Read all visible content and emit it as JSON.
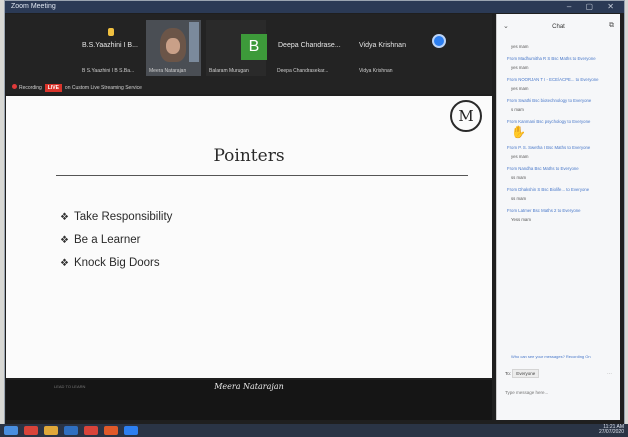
{
  "window": {
    "title": "Zoom Meeting"
  },
  "participants": [
    {
      "name": "B.S.Yaazhini I B...",
      "sub": "B S.Yaazhini I B S.Ba..."
    },
    {
      "name": "",
      "sub": "Meera Natarajan"
    },
    {
      "name": "",
      "avatar": "B",
      "sub": "Balaram Murugan"
    },
    {
      "name": "Deepa Chandrase...",
      "sub": "Deepa Chandrasekar..."
    },
    {
      "name": "Vidya Krishnan",
      "sub": "Vidya Krishnan"
    }
  ],
  "recording": {
    "label": "Recording",
    "live": "LIVE",
    "text": "on Custom Live Streaming Service"
  },
  "slide": {
    "logo": "M",
    "title": "Pointers",
    "bullets": [
      "Take Responsibility",
      "Be a Learner",
      "Knock Big Doors"
    ],
    "bullet_glyph": "❖",
    "footer_small": "LEAD TO LEARN",
    "footer_signature": "Meera Natarajan"
  },
  "chat": {
    "title": "Chat",
    "messages": [
      {
        "from": "",
        "text": "yes mam"
      },
      {
        "from": "From Madhumitha R S Bsc Maths to Everyone",
        "text": "yes mam"
      },
      {
        "from": "From NOORJAN T I - ECE/ACPE... to Everyone",
        "text": "yes mam"
      },
      {
        "from": "From Swathi Bsc biotechnology to Everyone",
        "text": "s mam"
      },
      {
        "from": "From Kanmani Bsc psychology to Everyone",
        "text": "",
        "thumb": true
      },
      {
        "from": "From P. S. Swetha I Bsc Maths to Everyone",
        "text": "yes mam"
      },
      {
        "from": "From Nandha Bsc Maths to Everyone",
        "text": "ss mam"
      },
      {
        "from": "From Dhakshin S Bsc Biolife... to Everyone",
        "text": "ss mam"
      },
      {
        "from": "From Latmer Bsc Maths 2 to Everyone",
        "text": "Yess mam"
      }
    ],
    "notice": "Who can see your messages? Recording On",
    "to_label": "To:",
    "to_value": "Everyone",
    "input_placeholder": "Type message here..."
  },
  "taskbar": {
    "time": "11:21 AM",
    "date": "27/07/2020"
  },
  "colors": {
    "accent": "#2d7ff0",
    "avatar_b": "#3d9a3a",
    "live": "#d9342b",
    "chat_link": "#4777c9"
  }
}
